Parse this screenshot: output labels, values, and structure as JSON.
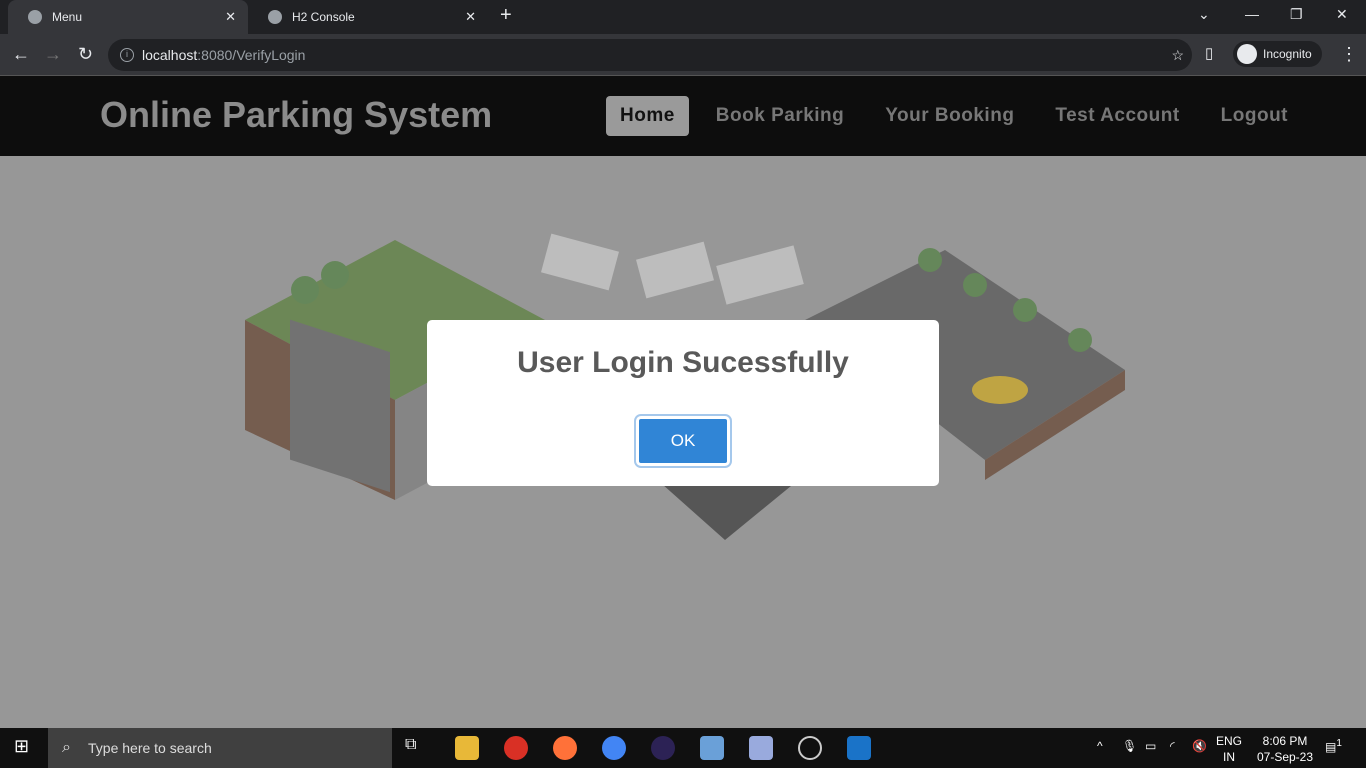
{
  "browser": {
    "tabs": [
      {
        "label": "Menu",
        "active": true
      },
      {
        "label": "H2 Console",
        "active": false
      }
    ],
    "url_host": "localhost",
    "url_rest": ":8080/VerifyLogin",
    "profile": "Incognito"
  },
  "site": {
    "brand": "Online Parking System",
    "menu": [
      "Home",
      "Book Parking",
      "Your Booking",
      "Test Account",
      "Logout"
    ],
    "active_menu": "Home"
  },
  "dialog": {
    "title": "User Login Sucessfully",
    "ok": "OK",
    "ok_color": "#3085d6"
  },
  "taskbar": {
    "search_placeholder": "Type here to search",
    "lang": "ENG",
    "region": "IN",
    "time": "8:06 PM",
    "date": "07-Sep-23",
    "notifications": "1"
  }
}
